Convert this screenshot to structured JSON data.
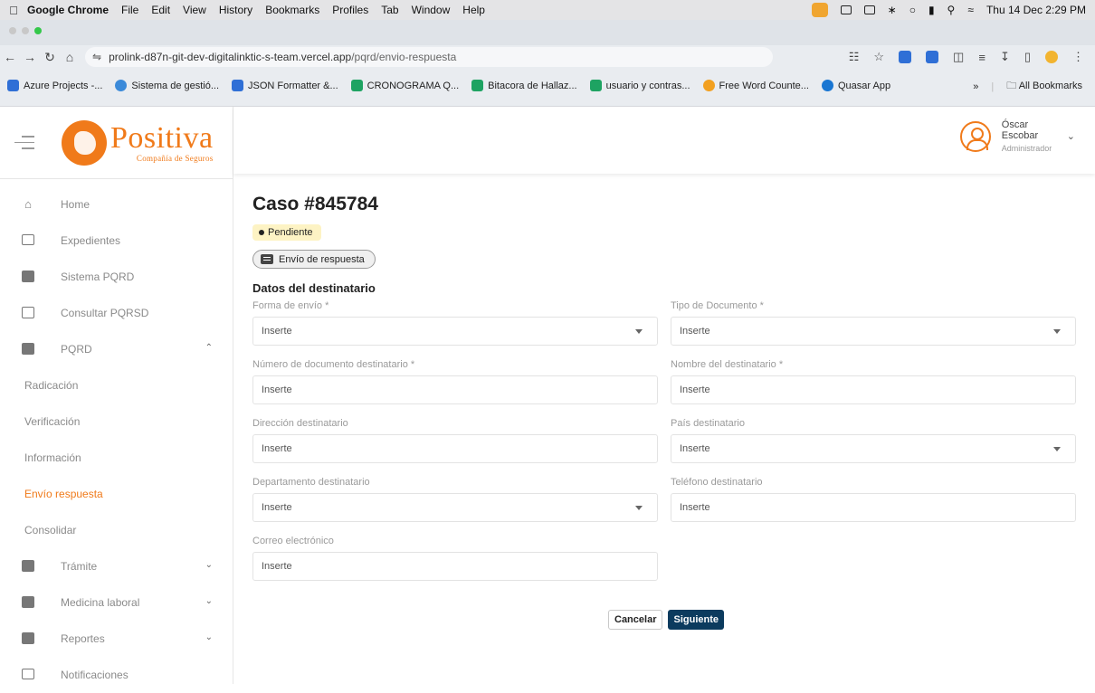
{
  "menubar": {
    "app": "Google Chrome",
    "items": [
      "File",
      "Edit",
      "View",
      "History",
      "Bookmarks",
      "Profiles",
      "Tab",
      "Window",
      "Help"
    ],
    "datetime": "Thu 14 Dec 2:29 PM"
  },
  "browser": {
    "url_host": "prolink-d87n-git-dev-digitalinktic-s-team.vercel.app",
    "url_path": "/pqrd/envio-respuesta",
    "bookmarks": [
      {
        "label": "Azure Projects -...",
        "color": "#2f6fd6"
      },
      {
        "label": "Sistema de gestió...",
        "color": "#3b8ad9"
      },
      {
        "label": "JSON Formatter &...",
        "color": "#2f6fd6"
      },
      {
        "label": "CRONOGRAMA Q...",
        "color": "#1ea362"
      },
      {
        "label": "Bitacora de Hallaz...",
        "color": "#1ea362"
      },
      {
        "label": "usuario y contras...",
        "color": "#1ea362"
      },
      {
        "label": "Free Word Counte...",
        "color": "#f2a020"
      },
      {
        "label": "Quasar App",
        "color": "#1976d2"
      }
    ],
    "more": "»",
    "all_bookmarks": "All Bookmarks"
  },
  "brand": {
    "logo_word": "Positiva",
    "logo_sub": "Compañía de Seguros",
    "accent_color": "#f07a1a"
  },
  "user": {
    "name": "Óscar Escobar",
    "role": "Administrador"
  },
  "sidebar": {
    "items": [
      {
        "label": "Home",
        "icon": "home-icon"
      },
      {
        "label": "Expedientes",
        "icon": "folder-icon"
      },
      {
        "label": "Sistema PQRD",
        "icon": "building-icon"
      },
      {
        "label": "Consultar PQRSD",
        "icon": "monitor-icon"
      },
      {
        "label": "PQRD",
        "icon": "id-card-icon",
        "expanded": true
      }
    ],
    "subitems": [
      {
        "label": "Radicación"
      },
      {
        "label": "Verificación"
      },
      {
        "label": "Información"
      },
      {
        "label": "Envío respuesta",
        "active": true
      },
      {
        "label": "Consolidar"
      }
    ],
    "more_items": [
      {
        "label": "Trámite",
        "icon": "id-card-icon"
      },
      {
        "label": "Medicina laboral",
        "icon": "briefcase-icon"
      },
      {
        "label": "Reportes",
        "icon": "briefcase-icon"
      },
      {
        "label": "Notificaciones",
        "icon": "folder-icon"
      }
    ]
  },
  "main": {
    "title": "Caso #845784",
    "status": "Pendiente",
    "status_color": "#fdf3c4",
    "step_chip": "Envío de respuesta",
    "section_title": "Datos del destinatario",
    "fields": [
      {
        "label": "Forma de envío *",
        "value": "Inserte",
        "type": "select"
      },
      {
        "label": "Tipo de Documento *",
        "value": "Inserte",
        "type": "select"
      },
      {
        "label": "Número de documento destinatario *",
        "value": "Inserte",
        "type": "text"
      },
      {
        "label": "Nombre del destinatario *",
        "value": "Inserte",
        "type": "text"
      },
      {
        "label": "Dirección destinatario",
        "value": "Inserte",
        "type": "text"
      },
      {
        "label": "País destinatario",
        "value": "Inserte",
        "type": "select"
      },
      {
        "label": "Departamento destinatario",
        "value": "Inserte",
        "type": "select"
      },
      {
        "label": "Teléfono destinatario",
        "value": "Inserte",
        "type": "text"
      },
      {
        "label": "Correo electrónico",
        "value": "Inserte",
        "type": "text"
      }
    ],
    "cancel_label": "Cancelar",
    "next_label": "Siguiente",
    "next_color": "#0c3b5e"
  }
}
